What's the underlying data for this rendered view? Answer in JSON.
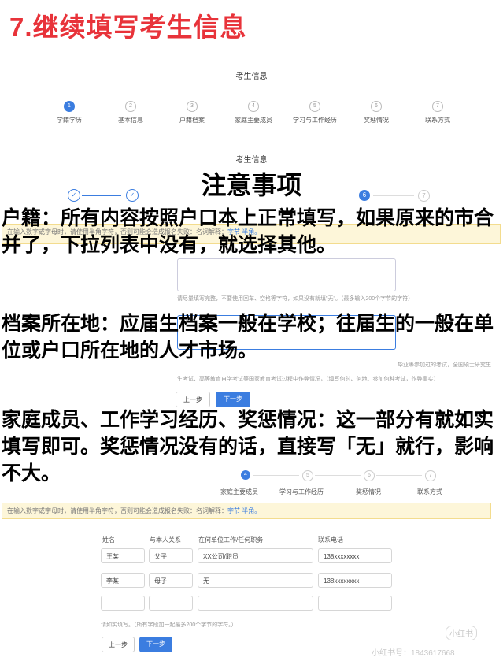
{
  "heading": "7.继续填写考生信息",
  "page_title": "考生信息",
  "steps": [
    {
      "num": "1",
      "label": "学籍学历"
    },
    {
      "num": "2",
      "label": "基本信息"
    },
    {
      "num": "3",
      "label": "户籍档案"
    },
    {
      "num": "4",
      "label": "家庭主要成员"
    },
    {
      "num": "5",
      "label": "学习与工作经历"
    },
    {
      "num": "6",
      "label": "奖惩情况"
    },
    {
      "num": "7",
      "label": "联系方式"
    }
  ],
  "section_title": "考生信息",
  "notice_title": "注意事项",
  "notes": {
    "huji": "户籍：所有内容按照户口本上正常填写，如果原来的市合并了，下拉列表中没有，就选择其他。",
    "dangan": "档案所在地：应届生档案一般在学校；往届生的一般在单位或户口所在地的人才市场。",
    "jiating": "家庭成员、工作学习经历、奖惩情况：这一部分有就如实填写即可。奖惩情况没有的话，直接写「无」就行，影响不大。"
  },
  "mid_form": {
    "notice_prefix": "在输入数字或字母时，请使用半角字符，否则可能会造成报名失败：名词解释：",
    "notice_link": "字节 半角。",
    "step6_num": "6",
    "step7_num": "7",
    "hint1": "请尽量填写完整，不要使用回车、空格等字符，如果没有就填\"无\"。（最多输入200个字节的字符）",
    "hint2a": "毕业等参加过的考试，全国硕士研究生",
    "hint2b": "生考试、高等教育自学考试等国家教育考试过程中作弊情况，（填写何时、何地、参加何种考试，作弊事实）",
    "prev": "上一步",
    "next": "下一步"
  },
  "bottom_form": {
    "steps": [
      {
        "num": "4",
        "label": "家庭主要成员"
      },
      {
        "num": "5",
        "label": "学习与工作经历"
      },
      {
        "num": "6",
        "label": "奖惩情况"
      },
      {
        "num": "7",
        "label": "联系方式"
      }
    ],
    "notice_prefix": "在输入数字或字母时，请使用半角字符，否则可能会造成报名失败：名词解释：",
    "notice_link": "字节 半角。",
    "headers": [
      "姓名",
      "与本人关系",
      "在何单位工作/任何职务",
      "联系电话"
    ],
    "rows": [
      [
        "王某",
        "父子",
        "XX公司/职员",
        "138xxxxxxxx"
      ],
      [
        "李某",
        "母子",
        "无",
        "138xxxxxxxx"
      ],
      [
        "",
        "",
        "",
        ""
      ]
    ],
    "hint": "请如实填写。（所有字段加一起最多200个字节的字符。）",
    "prev": "上一步",
    "next": "下一步"
  },
  "watermark": {
    "logo": "小红书",
    "id": "小红书号：1843617668"
  }
}
